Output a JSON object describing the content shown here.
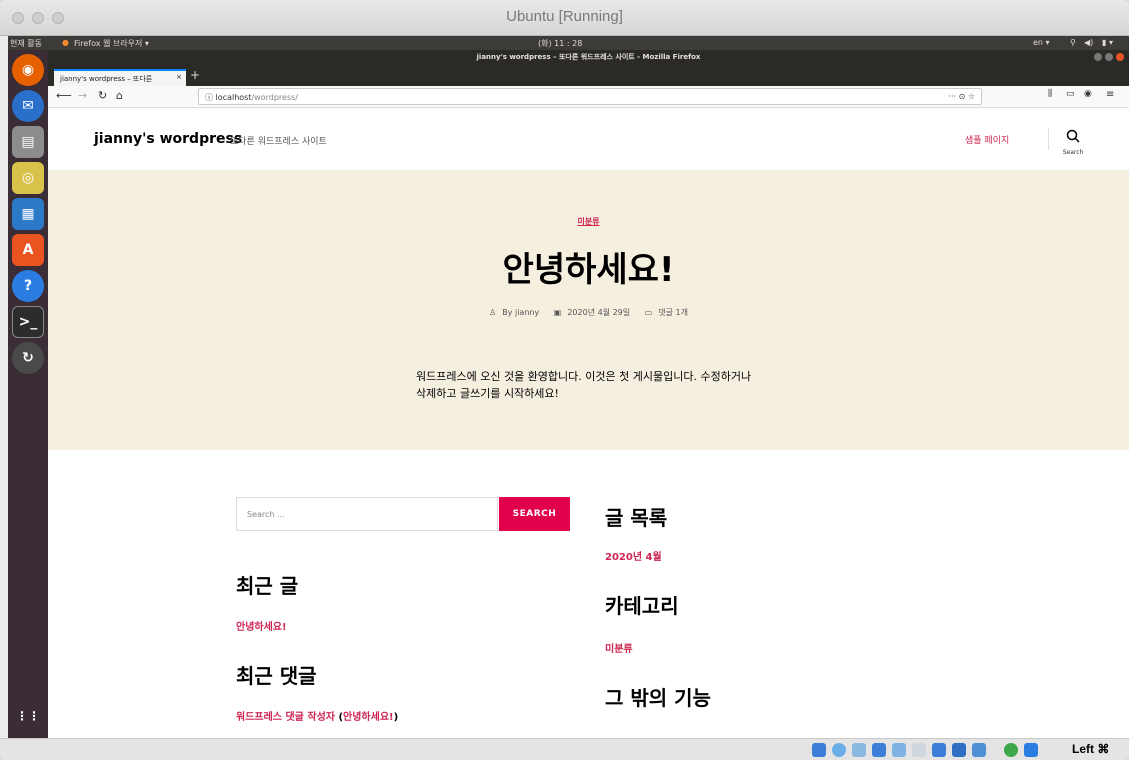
{
  "vm_window": {
    "title": "Ubuntu [Running]",
    "host_key": "Left ⌘"
  },
  "ubuntu_topbar": {
    "activities": "현재 활동",
    "app_menu": "Firefox 웹 브라우저 ▾",
    "clock": "(화) 11 : 28",
    "lang": "en ▾"
  },
  "firefox": {
    "window_title": "jianny's wordpress – 또다른 워드프레스 사이트 - Mozilla Firefox",
    "tab_label": "jianny's wordpress – 또다른",
    "url_host": "localhost",
    "url_path": "/wordpress/",
    "page_actions": "··· ⊙ ☆"
  },
  "site": {
    "title": "jianny's wordpress",
    "description": "또다른 워드프레스 사이트",
    "menu_item": "샘플 페이지",
    "search_label": "Search"
  },
  "post": {
    "category": "미분류",
    "title": "안녕하세요!",
    "author": "By jianny",
    "date": "2020년 4월 29일",
    "comments": "댓글 1개",
    "excerpt": "워드프레스에 오신 것을 환영합니다. 이것은 첫 게시물입니다. 수정하거나 삭제하고 글쓰기를 시작하세요!"
  },
  "widgets": {
    "search_placeholder": "Search …",
    "search_button": "SEARCH",
    "recent_posts_title": "최근 글",
    "recent_post_1": "안녕하세요!",
    "recent_comments_title": "최근 댓글",
    "recent_comment_author": "워드프레스 댓글 작성자",
    "recent_comment_paren_open": " (",
    "recent_comment_post": "안녕하세요!",
    "recent_comment_paren_close": ")",
    "archives_title": "글 목록",
    "archive_1": "2020년 4월",
    "categories_title": "카테고리",
    "category_1": "미분류",
    "meta_title": "그 밖의 기능"
  },
  "colors": {
    "accent": "#cd2653",
    "hero_bg": "#f5efe0",
    "button": "#e0004d",
    "launcher": "#3b2d35"
  }
}
